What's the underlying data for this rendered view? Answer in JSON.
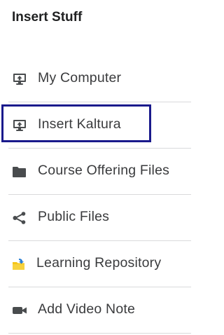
{
  "panel": {
    "title": "Insert Stuff"
  },
  "items": [
    {
      "label": "My Computer",
      "icon": "monitor-upload-icon"
    },
    {
      "label": "Insert Kaltura",
      "icon": "monitor-upload-icon"
    },
    {
      "label": "Course Offering Files",
      "icon": "folder-icon"
    },
    {
      "label": "Public Files",
      "icon": "share-icon"
    },
    {
      "label": "Learning Repository",
      "icon": "repository-icon"
    },
    {
      "label": "Add Video Note",
      "icon": "video-camera-icon"
    }
  ],
  "colors": {
    "focus_outline": "#1a1a8c",
    "icon": "#494c4e",
    "text": "#3a3b3d",
    "divider": "#d9dadb",
    "repository_yellow": "#f5c518",
    "repository_blue": "#2a7fd4"
  }
}
